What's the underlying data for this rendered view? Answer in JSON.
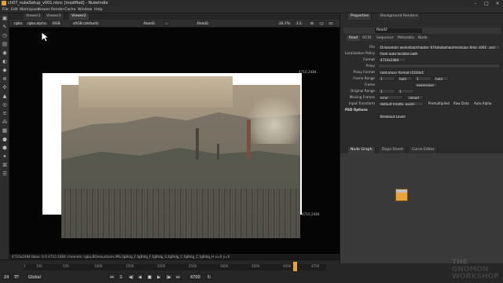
{
  "titlebar": {
    "title": "ch07_nukeSetup_v001.nknc [modified] - NukeIndie",
    "minimize": "–",
    "maximize": "□",
    "close": "×"
  },
  "menu": [
    "File",
    "Edit",
    "Workspace",
    "Viewer",
    "Render",
    "Cache",
    "Window",
    "Help"
  ],
  "viewer": {
    "tabs": [
      "Viewer1",
      "Viewer3",
      "Viewer2"
    ],
    "channels": "rgba",
    "layer": "rgba.alpha",
    "node_a": "Read2",
    "node_b": "Read2",
    "colorspace": "sRGB (default)",
    "zoom": "32.7%",
    "ratio": "1:1",
    "coord_top_right": "4710,2484",
    "coord_bottom_right": "4710,2484",
    "info": "4710x2484  bbox: 0 0 4710 2484 channels: rgba,BGmountains.MG,fgBldg_F,fgBldg_F,fgBldg_G,fgBldg_C,fgBldg_C,fgBldg_H  x=0 y=0"
  },
  "timeline": {
    "ticks": [
      "1",
      "100",
      "500",
      "1000",
      "1500",
      "2000",
      "2500",
      "3000",
      "3500",
      "4000",
      "4700"
    ],
    "fps": "24",
    "mode": "Global",
    "frame": "1",
    "end_frame": "4700"
  },
  "properties": {
    "tabs": [
      "Properties",
      "Background Renders"
    ],
    "node_name": "Read2",
    "subtabs": [
      "Read",
      "OCIO",
      "Sequence",
      "Metadata",
      "Node"
    ],
    "fields": {
      "file": "D:/gnomon_workshop/chapter_07/photoshop/mockups_6mp_v001_.psd",
      "localization_policy": "from auto-localize path",
      "format": "4710x2484",
      "proxy": "",
      "proxy_format": "root.proxy_format (2334x1773)",
      "frame_range_start": "1",
      "frame_range_before": "hold",
      "frame_range_end": "1",
      "frame_range_after": "hold",
      "frame_mode": "expression",
      "original_range_start": "1",
      "original_range_end": "1",
      "missing_frames": "error",
      "reload": "reload",
      "input_transform": "default (matte_paint)",
      "premultiplied": "Premultiplied",
      "raw_data": "Raw Data",
      "auto_alpha": "Auto Alpha",
      "psd_options": "PSD Options",
      "breakout_layers": "Breakout Layers"
    },
    "labels": {
      "file": "File",
      "localization_policy": "Localization Policy",
      "format": "Format",
      "proxy": "Proxy",
      "proxy_format": "Proxy Format",
      "frame_range": "Frame Range",
      "frame": "Frame",
      "original_range": "Original Range",
      "missing_frames": "Missing Frames",
      "input_transform": "Input Transform"
    }
  },
  "nodegraph": {
    "tabs": [
      "Node Graph",
      "Dope Sheet",
      "Curve Editor"
    ]
  },
  "watermark": "THE GNOMON WORKSHOP",
  "colors": {
    "accent": "#e8a33a",
    "bg": "#1f1f1f"
  }
}
